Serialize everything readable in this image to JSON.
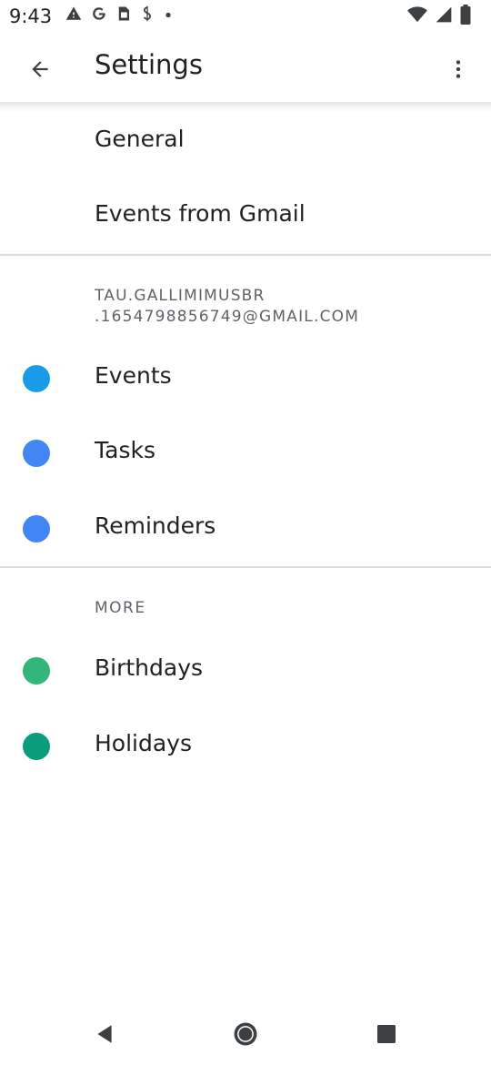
{
  "status_bar": {
    "time": "9:43",
    "left_icons": [
      "warning-icon",
      "google-icon",
      "sim-card-icon",
      "shopping-icon",
      "dot-icon"
    ],
    "right_icons": [
      "wifi-icon",
      "signal-icon",
      "battery-icon"
    ]
  },
  "app_bar": {
    "title": "Settings",
    "back_icon": "arrow-back-icon",
    "overflow_icon": "more-vert-icon"
  },
  "sections": {
    "general_label": "General",
    "events_from_gmail_label": "Events from Gmail",
    "account_line1": "TAU.GALLIMIMUSBR",
    "account_line2": ".1654798856749@GMAIL.COM",
    "calendars": [
      {
        "label": "Events",
        "color": "#1a9be8"
      },
      {
        "label": "Tasks",
        "color": "#4285f4"
      },
      {
        "label": "Reminders",
        "color": "#4285f4"
      }
    ],
    "more_header": "MORE",
    "more_calendars": [
      {
        "label": "Birthdays",
        "color": "#33b679"
      },
      {
        "label": "Holidays",
        "color": "#0b9d79"
      }
    ]
  },
  "nav_bar": {
    "back_icon": "nav-back-icon",
    "home_icon": "nav-home-icon",
    "recents_icon": "nav-recents-icon"
  },
  "colors": {
    "text_primary": "#202124",
    "text_secondary": "#5f6368",
    "divider": "#dadce0"
  }
}
